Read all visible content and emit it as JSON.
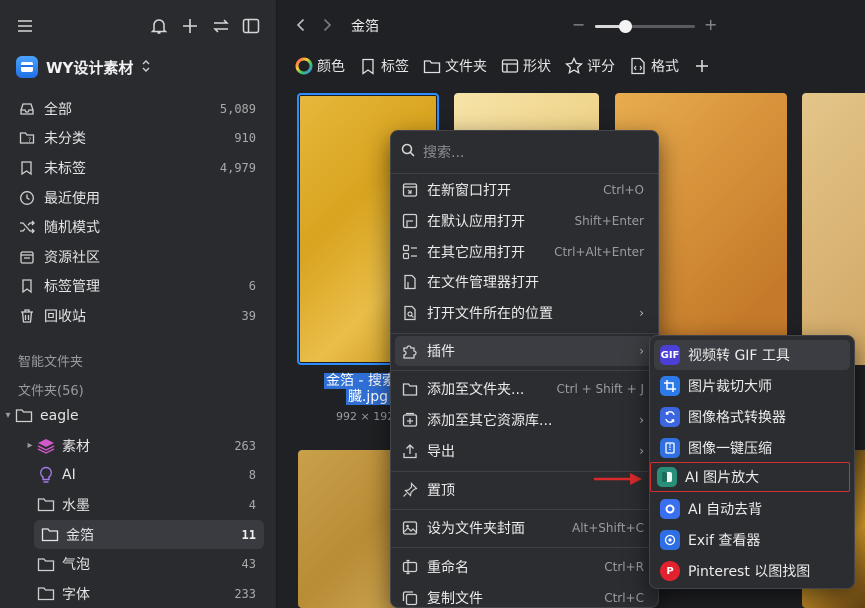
{
  "sidebar": {
    "library_name": "WY设计素材",
    "nav": [
      {
        "label": "全部",
        "count": "5,089",
        "icon": "inbox-icon"
      },
      {
        "label": "未分类",
        "count": "910",
        "icon": "folder-question-icon"
      },
      {
        "label": "未标签",
        "count": "4,979",
        "icon": "tag-question-icon"
      },
      {
        "label": "最近使用",
        "count": "",
        "icon": "clock-icon"
      },
      {
        "label": "随机模式",
        "count": "",
        "icon": "shuffle-icon"
      },
      {
        "label": "资源社区",
        "count": "",
        "icon": "community-icon"
      },
      {
        "label": "标签管理",
        "count": "6",
        "icon": "bookmark-icon"
      },
      {
        "label": "回收站",
        "count": "39",
        "icon": "trash-icon"
      }
    ],
    "smart_folders_label": "智能文件夹",
    "folders_label": "文件夹(56)",
    "tree": [
      {
        "label": "eagle",
        "count": ""
      },
      {
        "label": "素材",
        "count": "263"
      },
      {
        "label": "AI",
        "count": "8"
      },
      {
        "label": "水墨",
        "count": "4"
      },
      {
        "label": "金箔",
        "count": "11"
      },
      {
        "label": "气泡",
        "count": "43"
      },
      {
        "label": "字体",
        "count": "233"
      }
    ]
  },
  "main": {
    "breadcrumb": "金箔",
    "zoom_level": 0.3,
    "filters": [
      {
        "label": "颜色",
        "icon": "color-wheel-icon"
      },
      {
        "label": "标签",
        "icon": "bookmark-icon"
      },
      {
        "label": "文件夹",
        "icon": "folder-icon"
      },
      {
        "label": "形状",
        "icon": "shape-icon"
      },
      {
        "label": "评分",
        "icon": "star-icon"
      },
      {
        "label": "格式",
        "icon": "file-format-icon"
      }
    ],
    "selected_caption_highlight": "金箔 - 搜索结",
    "selected_caption_rest": "臓.jpg",
    "selected_dims": "992 × 192"
  },
  "context_menu": {
    "search_placeholder": "搜索...",
    "items": [
      {
        "label": "在新窗口打开",
        "shortcut": "Ctrl+O",
        "icon": "new-window-icon"
      },
      {
        "label": "在默认应用打开",
        "shortcut": "Shift+Enter",
        "icon": "open-default-icon"
      },
      {
        "label": "在其它应用打开",
        "shortcut": "Ctrl+Alt+Enter",
        "icon": "open-with-icon"
      },
      {
        "label": "在文件管理器打开",
        "shortcut": "",
        "icon": "file-manager-icon"
      },
      {
        "label": "打开文件所在的位置",
        "shortcut": "",
        "icon": "file-location-icon",
        "submenu": true
      },
      {
        "label": "插件",
        "shortcut": "",
        "icon": "puzzle-icon",
        "submenu": true
      },
      {
        "label": "添加至文件夹...",
        "shortcut": "Ctrl + Shift + J",
        "icon": "add-folder-icon"
      },
      {
        "label": "添加至其它资源库...",
        "shortcut": "",
        "icon": "add-library-icon",
        "submenu": true
      },
      {
        "label": "导出",
        "shortcut": "",
        "icon": "export-icon",
        "submenu": true
      },
      {
        "label": "置顶",
        "shortcut": "",
        "icon": "pin-icon"
      },
      {
        "label": "设为文件夹封面",
        "shortcut": "Alt+Shift+C",
        "icon": "image-icon"
      },
      {
        "label": "重命名",
        "shortcut": "Ctrl+R",
        "icon": "rename-icon"
      },
      {
        "label": "复制文件",
        "shortcut": "Ctrl+C",
        "icon": "copy-file-icon"
      }
    ]
  },
  "plugin_submenu": {
    "items": [
      {
        "label": "视频转 GIF 工具",
        "color": "#4b3fd6"
      },
      {
        "label": "图片裁切大师",
        "color": "#2d7be8"
      },
      {
        "label": "图像格式转换器",
        "color": "#3b66e0"
      },
      {
        "label": "图像一键压缩",
        "color": "#2f6fe0"
      },
      {
        "label": "AI 图片放大",
        "color": "#2a8f7a"
      },
      {
        "label": "AI 自动去背",
        "color": "#3a6ff0"
      },
      {
        "label": "Exif 查看器",
        "color": "#2f6fe6"
      },
      {
        "label": "Pinterest 以图找图",
        "color": "#e2222f"
      }
    ]
  },
  "colors": {
    "accent": "#2d8cff",
    "highlight_box": "#d03030"
  }
}
